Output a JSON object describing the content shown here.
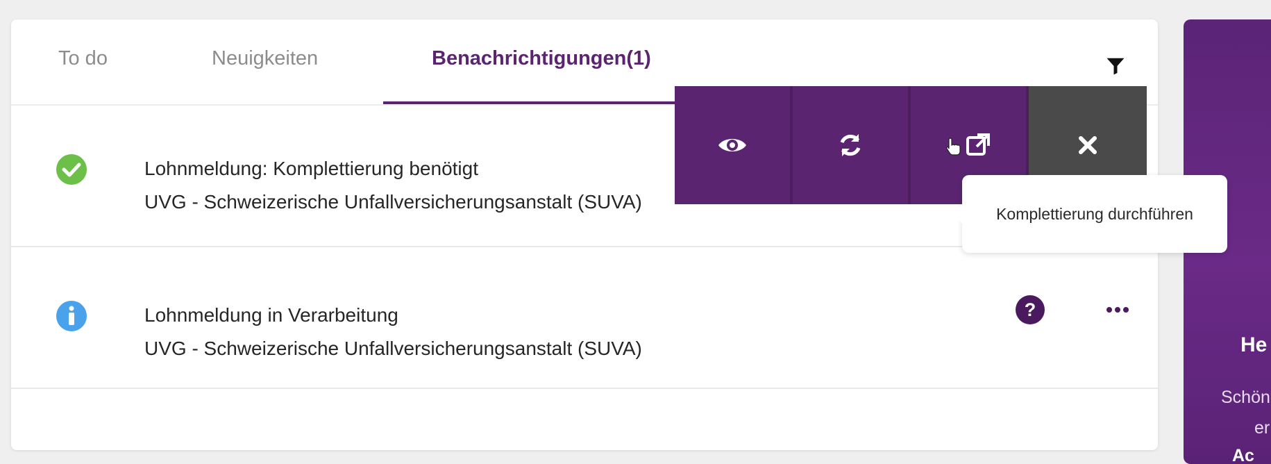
{
  "tabs": {
    "todo": "To do",
    "news": "Neuigkeiten",
    "notifications": "Benachrichtigungen(1)"
  },
  "notifications": [
    {
      "status_icon": "check-circle-icon",
      "title": "Lohnmeldung: Komplettierung benötigt",
      "subtitle": "UVG - Schweizerische Unfallversicherungsanstalt (SUVA)"
    },
    {
      "status_icon": "info-circle-icon",
      "title": "Lohnmeldung in Verarbeitung",
      "subtitle": "UVG - Schweizerische Unfallversicherungsanstalt (SUVA)"
    }
  ],
  "action_icons": [
    "eye-icon",
    "refresh-icon",
    "external-link-icon",
    "close-icon"
  ],
  "tooltip": "Komplettierung durchführen",
  "side_panel": {
    "title": "He",
    "line1": "Schön",
    "line2": "er",
    "line3": "Ac"
  },
  "colors": {
    "accent": "#5a2470",
    "success": "#6cc04a",
    "info": "#4aa3ea",
    "close_bg": "#4a4a4a"
  }
}
